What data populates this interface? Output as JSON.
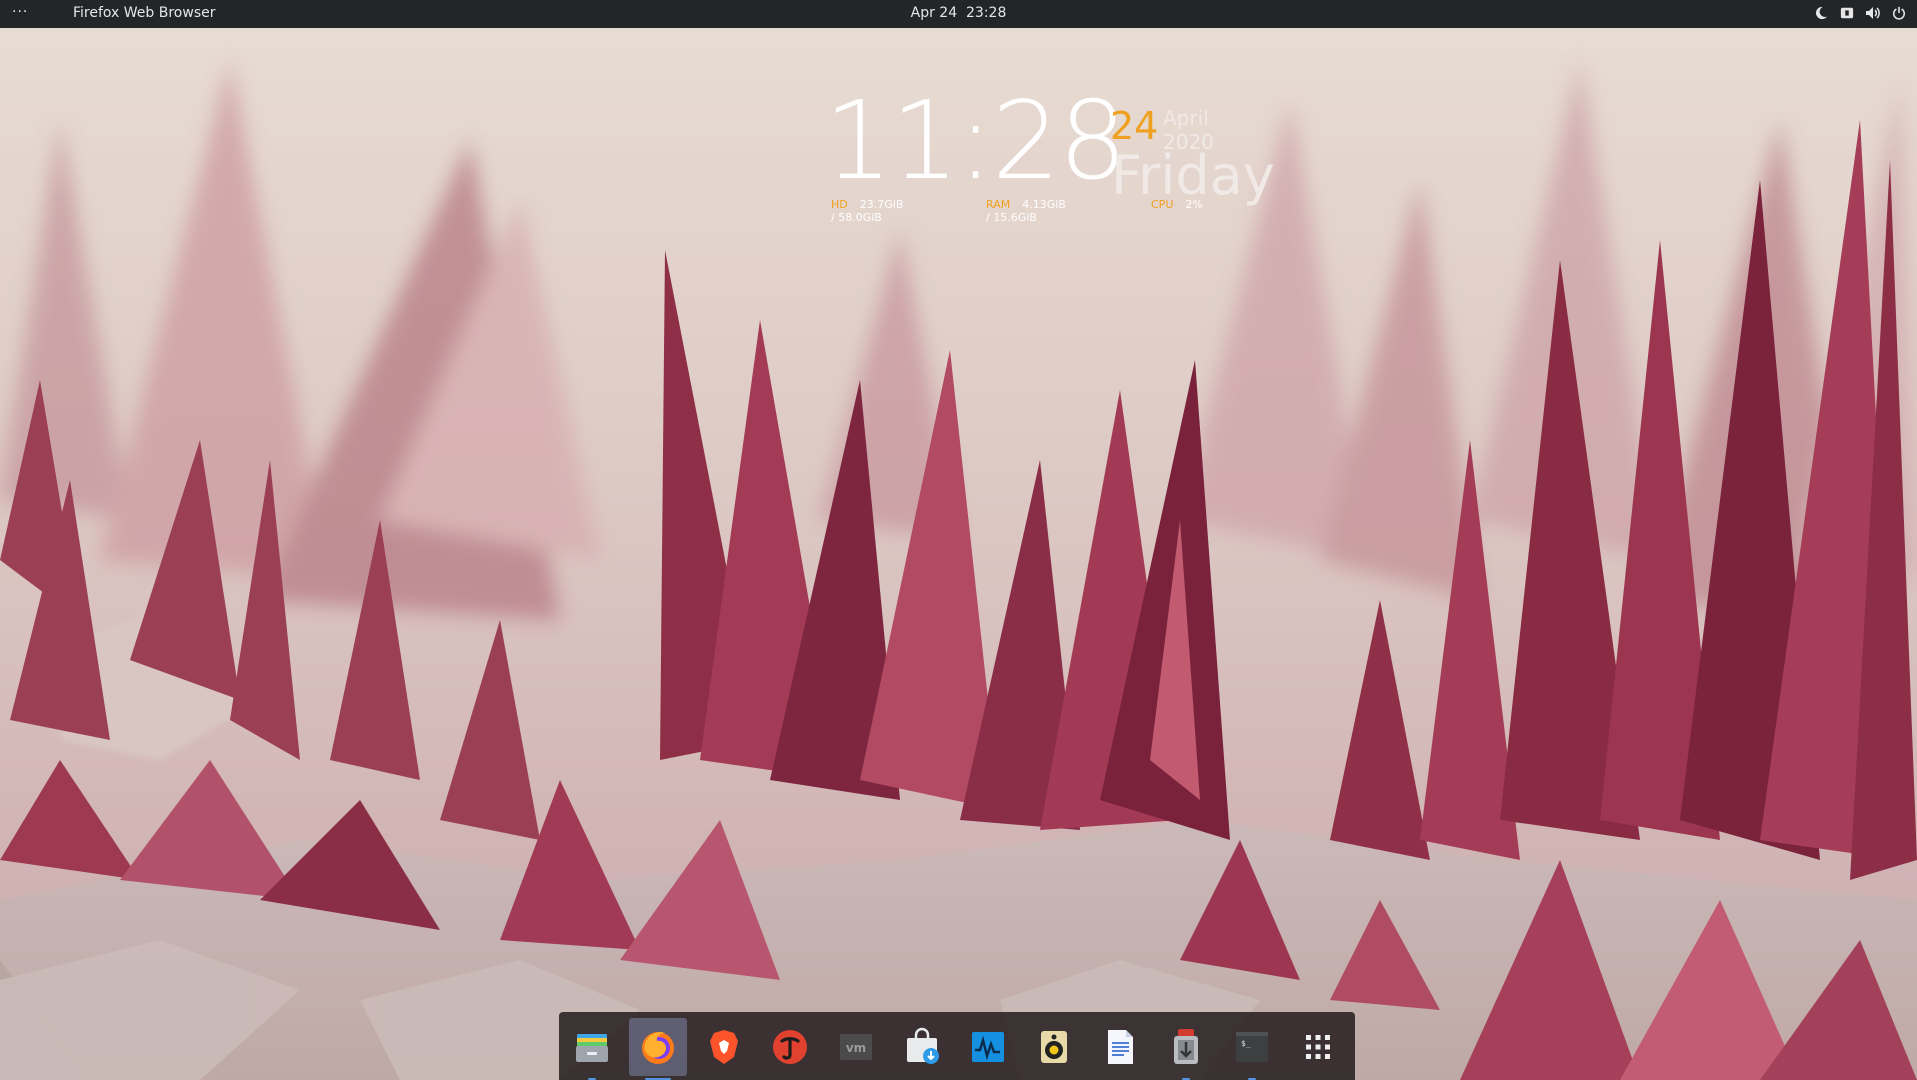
{
  "topbar": {
    "menu_label": "···",
    "app_name": "Firefox Web Browser",
    "date": "Apr 24",
    "time": "23:28",
    "tray_icons": [
      "night-light-icon",
      "keyboard-layout-icon",
      "volume-icon",
      "power-icon"
    ]
  },
  "conky": {
    "time": "11:28",
    "day": "24",
    "month_year": "April 2020",
    "weekday": "Friday",
    "stats": [
      {
        "label": "HD",
        "value": "23.7GiB / 58.0GiB"
      },
      {
        "label": "RAM",
        "value": "4.13GiB / 15.6GiB"
      },
      {
        "label": "CPU",
        "value": "2%"
      }
    ],
    "accent_color": "#f0a020"
  },
  "dock": {
    "items": [
      {
        "name": "files-icon",
        "running": true,
        "active": false
      },
      {
        "name": "firefox-icon",
        "running": true,
        "active": true
      },
      {
        "name": "brave-icon",
        "running": false,
        "active": false
      },
      {
        "name": "typora-icon",
        "running": false,
        "active": false
      },
      {
        "name": "vmware-icon",
        "running": false,
        "active": false
      },
      {
        "name": "software-store-icon",
        "running": false,
        "active": false
      },
      {
        "name": "system-monitor-icon",
        "running": false,
        "active": false
      },
      {
        "name": "rhythmbox-icon",
        "running": false,
        "active": false
      },
      {
        "name": "text-editor-icon",
        "running": false,
        "active": false
      },
      {
        "name": "transmission-icon",
        "running": true,
        "active": false
      },
      {
        "name": "terminal-icon",
        "running": true,
        "active": false
      },
      {
        "name": "app-grid-icon",
        "running": false,
        "active": false
      }
    ],
    "active_color": "#5294e2"
  }
}
